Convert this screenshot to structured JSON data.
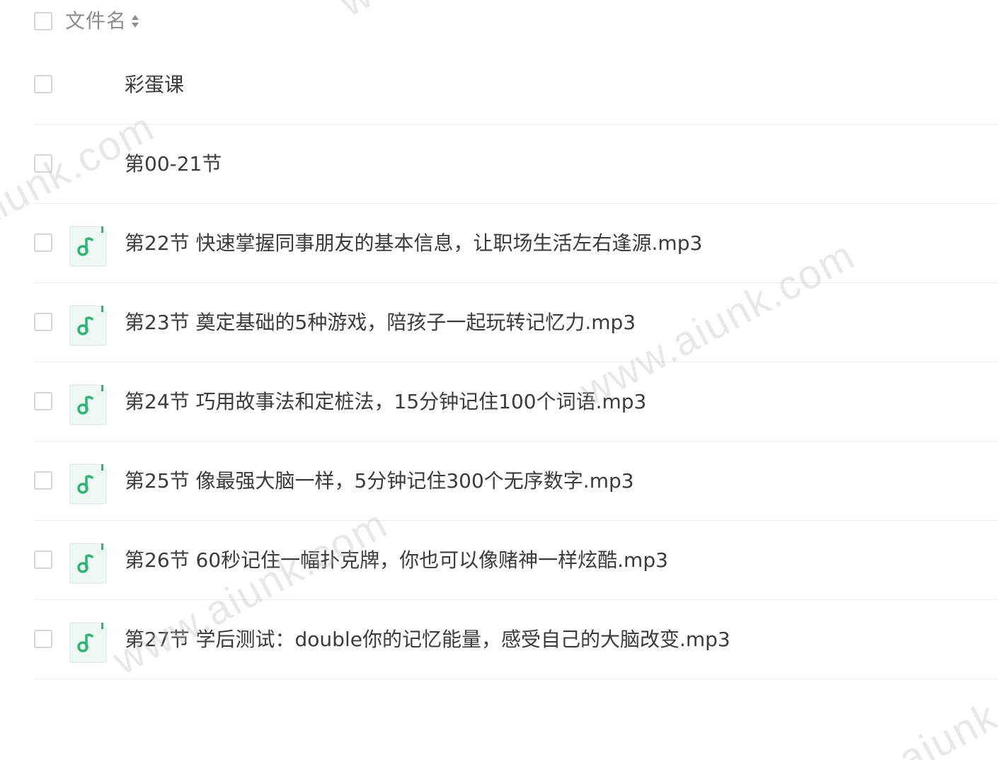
{
  "header": {
    "column_label": "文件名",
    "sort_icon": "sort-updown-icon"
  },
  "files": [
    {
      "name": "彩蛋课",
      "type": "folder",
      "icon": "folder-icon"
    },
    {
      "name": "第00-21节",
      "type": "folder",
      "icon": "folder-icon"
    },
    {
      "name": "第22节 快速掌握同事朋友的基本信息，让职场生活左右逢源.mp3",
      "type": "audio",
      "icon": "music-file-icon"
    },
    {
      "name": "第23节 奠定基础的5种游戏，陪孩子一起玩转记忆力.mp3",
      "type": "audio",
      "icon": "music-file-icon"
    },
    {
      "name": "第24节 巧用故事法和定桩法，15分钟记住100个词语.mp3",
      "type": "audio",
      "icon": "music-file-icon"
    },
    {
      "name": "第25节 像最强大脑一样，5分钟记住300个无序数字.mp3",
      "type": "audio",
      "icon": "music-file-icon"
    },
    {
      "name": "第26节 60秒记住一幅扑克牌，你也可以像赌神一样炫酷.mp3",
      "type": "audio",
      "icon": "music-file-icon"
    },
    {
      "name": "第27节 学后测试：double你的记忆能量，感受自己的大脑改变.mp3",
      "type": "audio",
      "icon": "music-file-icon"
    }
  ],
  "watermarks": [
    "www.aiunk.com",
    "aiunk.com",
    "www.aiunk.com",
    "www.aiunk.com",
    "aiunk"
  ],
  "colors": {
    "folder": "#7ab8ec",
    "audio_accent": "#2bb673",
    "text": "#3b3b3b",
    "header_text": "#8d8d8d"
  }
}
